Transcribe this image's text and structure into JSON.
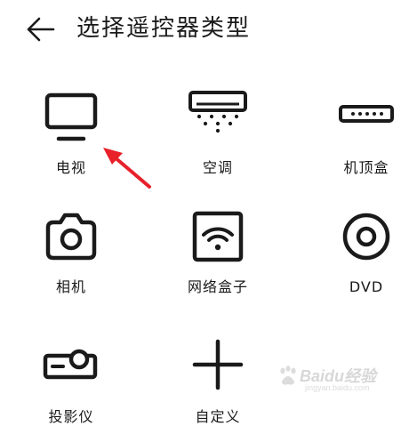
{
  "header": {
    "back_icon": "arrow-left-icon",
    "title": "选择遥控器类型"
  },
  "devices": [
    {
      "label": "电视",
      "icon": "tv-icon"
    },
    {
      "label": "空调",
      "icon": "air-conditioner-icon"
    },
    {
      "label": "机顶盒",
      "icon": "set-top-box-icon"
    },
    {
      "label": "相机",
      "icon": "camera-icon"
    },
    {
      "label": "网络盒子",
      "icon": "network-box-icon"
    },
    {
      "label": "DVD",
      "icon": "dvd-icon"
    },
    {
      "label": "投影仪",
      "icon": "projector-icon"
    },
    {
      "label": "自定义",
      "icon": "plus-icon"
    }
  ],
  "annotation": {
    "arrow_color": "#e8202a"
  },
  "watermark": {
    "brand": "Baidu经验",
    "url": "jingyan.baidu.com"
  },
  "colors": {
    "icon_stroke": "#1a1a1a",
    "text": "#1a1a1a",
    "background": "#ffffff"
  }
}
